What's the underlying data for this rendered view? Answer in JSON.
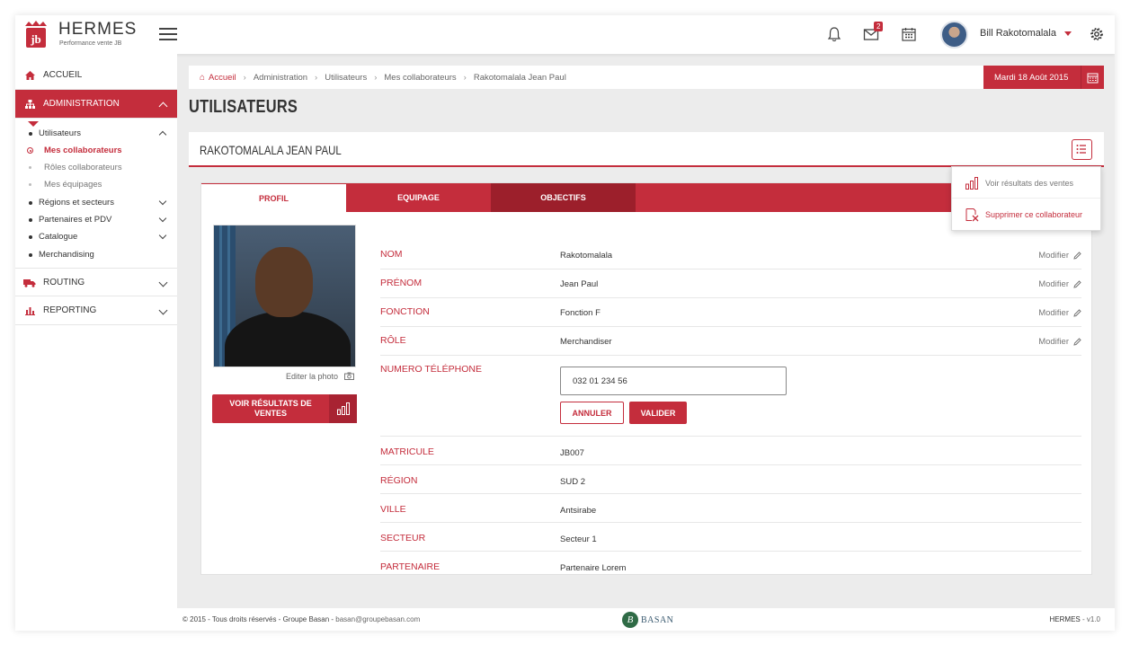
{
  "app": {
    "brand": "HERMES",
    "tagline": "Performance vente JB",
    "accent": "#c42d3c"
  },
  "header": {
    "mail_count": "2",
    "user_name": "Bill Rakotomalala"
  },
  "sidebar": {
    "items": [
      {
        "label": "ACCUEIL"
      },
      {
        "label": "ADMINISTRATION"
      },
      {
        "label": "ROUTING"
      },
      {
        "label": "REPORTING"
      }
    ],
    "admin_sub": [
      {
        "label": "Utilisateurs"
      },
      {
        "label": "Mes collaborateurs"
      },
      {
        "label": "Rôles collaborateurs"
      },
      {
        "label": "Mes équipages"
      },
      {
        "label": "Régions et secteurs"
      },
      {
        "label": "Partenaires et PDV"
      },
      {
        "label": "Catalogue"
      },
      {
        "label": "Merchandising"
      }
    ]
  },
  "breadcrumb": [
    "Accueil",
    "Administration",
    "Utilisateurs",
    "Mes collaborateurs",
    "Rakotomalala Jean Paul"
  ],
  "date_label": "Mardi 18 Août 2015",
  "page_title": "UTILISATEURS",
  "profile_header": "RAKOTOMALALA JEAN PAUL",
  "menu": {
    "view_sales": "Voir résultats des ventes",
    "delete": "Supprimer ce collaborateur"
  },
  "tabs": [
    {
      "label": "PROFIL"
    },
    {
      "label": "EQUIPAGE"
    },
    {
      "label": "OBJECTIFS"
    }
  ],
  "photo_edit": "Editer la photo",
  "sales_button": "VOIR RÉSULTATS DE VENTES",
  "fields": [
    {
      "label": "NOM",
      "value": "Rakotomalala",
      "action": "Modifier"
    },
    {
      "label": "PRÉNOM",
      "value": "Jean Paul",
      "action": "Modifier"
    },
    {
      "label": "FONCTION",
      "value": "Fonction F",
      "action": "Modifier"
    },
    {
      "label": "RÔLE",
      "value": "Merchandiser",
      "action": "Modifier"
    }
  ],
  "phone": {
    "label": "NUMERO TÉLÉPHONE",
    "value": "032 01 234 56",
    "cancel": "ANNULER",
    "confirm": "VALIDER"
  },
  "info": [
    {
      "label": "MATRICULE",
      "value": "JB007"
    },
    {
      "label": "RÉGION",
      "value": "SUD 2"
    },
    {
      "label": "VILLE",
      "value": "Antsirabe"
    },
    {
      "label": "SECTEUR",
      "value": "Secteur 1"
    },
    {
      "label": "PARTENAIRE",
      "value": "Partenaire Lorem"
    }
  ],
  "footer": {
    "copyright": "© 2015 - Tous droits réservés - Groupe Basan -",
    "email": "basan@groupebasan.com",
    "logo_text": "BASAN",
    "app_name": "HERMES",
    "version": "- v1.0"
  }
}
